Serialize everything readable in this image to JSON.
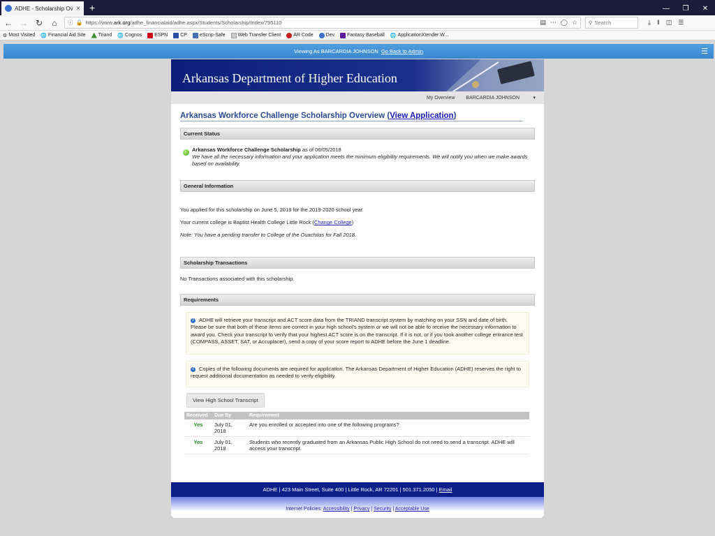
{
  "browser": {
    "tab_title": "ADHE - Scholarship Overview",
    "tab_close": "×",
    "new_tab": "+",
    "url_prefix": "https://www.",
    "url_domain": "ark.org",
    "url_path": "/adhe_financialaid/adhe.aspx/Students/Scholarship/Index/795110",
    "search_placeholder": "Search",
    "bookmarks": [
      "Most Visited",
      "Financial Aid Site",
      "Triand",
      "Cognos",
      "ESPN",
      "CP",
      "eScrip-Safe",
      "Web Transfer Client",
      "AR Code",
      "Dev",
      "Fantasy Baseball",
      "ApplicationXtender W..."
    ]
  },
  "admin_bar": {
    "text": "Viewing As BARCARDIA JOHNSON",
    "link": "Go Back to Admin"
  },
  "header": {
    "title": "Arkansas Department of Higher Education",
    "my_overview": "My Overview",
    "user_name": "BARCARDIA JOHNSON",
    "user_caret": "▾"
  },
  "page": {
    "title": "Arkansas Workforce Challenge Scholarship Overview",
    "title_link": "View Application"
  },
  "current_status": {
    "header": "Current Status",
    "scholarship": "Arkansas Workforce Challenge Scholarship",
    "as_of": "as of 06/05/2018",
    "message": "We have all the necessary information and your application meets the minimum eligibility requirements. We will notify you when we make awards based on availability."
  },
  "general_info": {
    "header": "General Information",
    "applied": "You applied for this scholarship on June 5, 2018 for the 2019-2020 school year.",
    "college": "Your current college is Baptist Health College Little Rock",
    "change_college": "Change College",
    "note": "Note: You have a pending transfer to College of the Ouachitas for Fall 2018."
  },
  "transactions": {
    "header": "Scholarship Transactions",
    "empty": "No Transactions associated with this scholarship."
  },
  "requirements": {
    "header": "Requirements",
    "info1": "ADHE will retrieve your transcript and ACT score data from the TRIAND transcript system by matching on your SSN and date of birth. Please be sure that both of these items are correct in your high school's system or we will not be able to receive the necessary information to award you. Check your transcript to verify that your highest ACT score is on the transcript. If it is not, or if you took another college entrance test (COMPASS, ASSET, SAT, or Accuplacer), send a copy of your score report to ADHE before the June 1 deadline.",
    "info2": "Copies of the following documents are required for application. The Arkansas Department of Higher Education (ADHE) reserves the right to request additional documentation as needed to verify eligibility.",
    "button": "View High School Transcript",
    "columns": [
      "Received",
      "Due By",
      "Requirement"
    ],
    "rows": [
      {
        "received": "Yes",
        "due": "July 01, 2018",
        "requirement": "Are you enrolled or accepted into one of the following programs?"
      },
      {
        "received": "Yes",
        "due": "July 01, 2018",
        "requirement": "Students who recently graduated from an Arkansas Public High School do not need to send a transcript. ADHE will access your transcript."
      }
    ]
  },
  "footer": {
    "address": "ADHE | 423 Main Street, Suite 400 | Little Rock, AR 72201 | 501.371.2050 |",
    "email": "Email",
    "policies_label": "Internet Policies:",
    "accessibility": "Accessibility",
    "privacy": "Privacy",
    "security": "Security",
    "acceptable_use": "Acceptable Use"
  }
}
